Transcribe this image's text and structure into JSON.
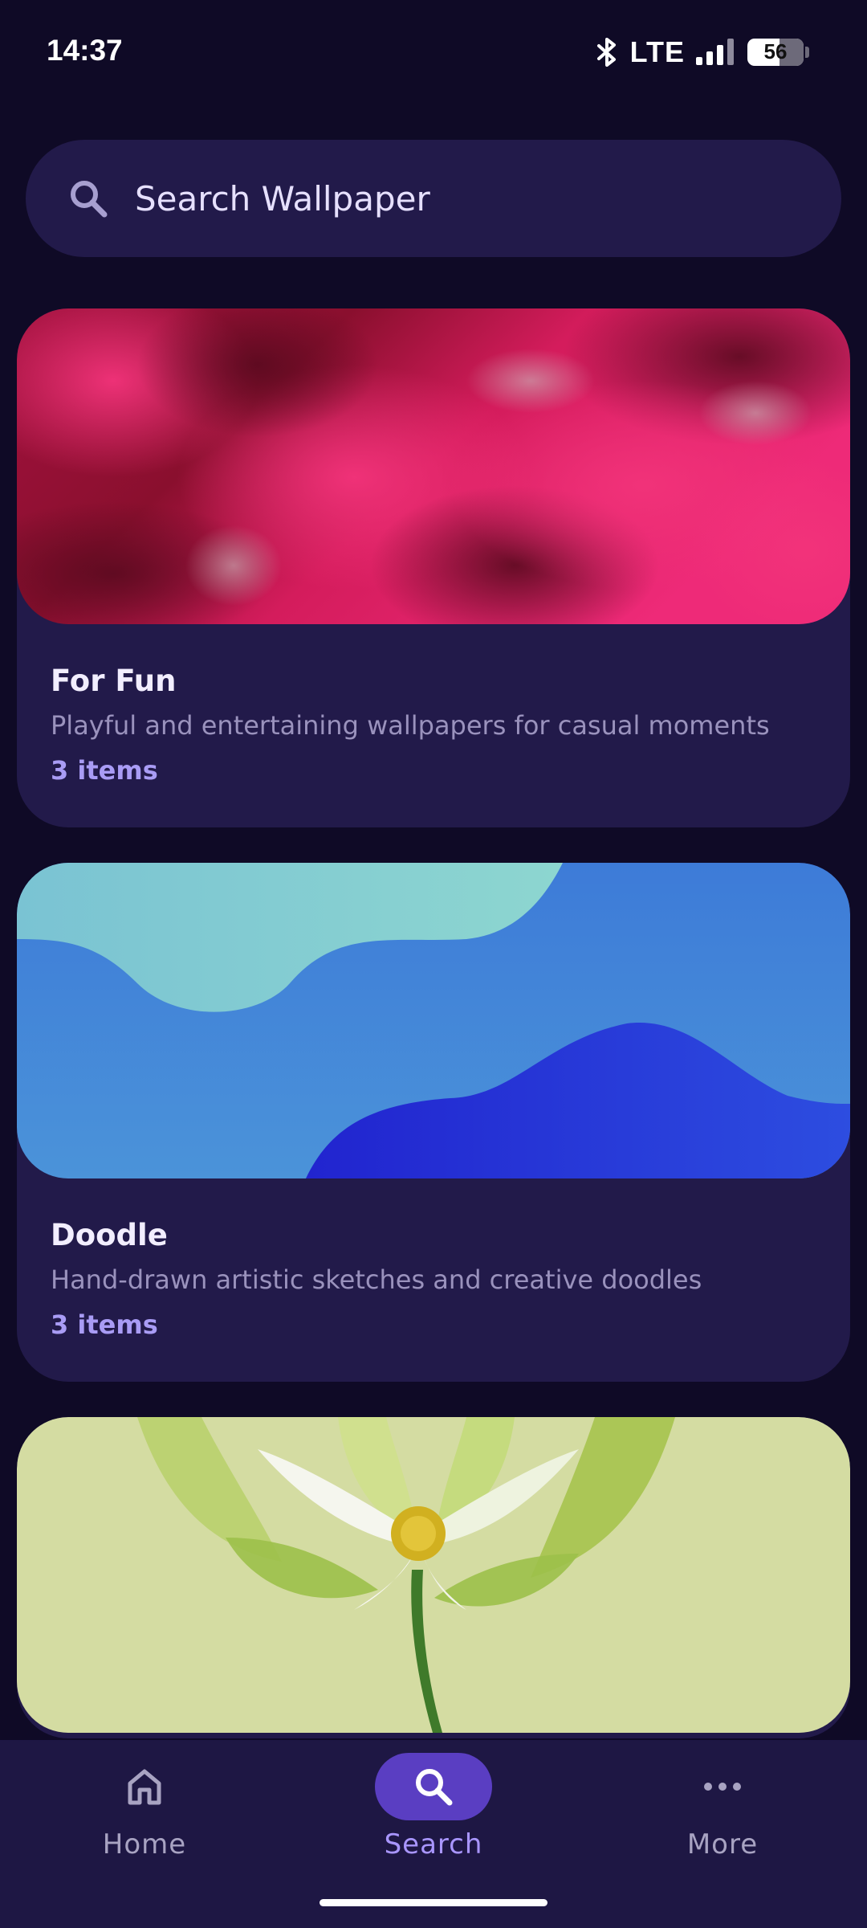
{
  "status_bar": {
    "time": "14:37",
    "network": "LTE",
    "battery": "56",
    "icons": [
      "bluetooth-icon",
      "signal-icon",
      "battery-icon"
    ]
  },
  "search": {
    "placeholder": "Search Wallpaper",
    "icon": "search-icon"
  },
  "categories": [
    {
      "title": "For Fun",
      "description": "Playful and entertaining wallpapers for casual moments",
      "count": "3 items",
      "image": "pink-clouds"
    },
    {
      "title": "Doodle",
      "description": "Hand-drawn artistic sketches and creative doodles",
      "count": "3 items",
      "image": "blue-waves"
    },
    {
      "title": "",
      "description": "",
      "count": "",
      "image": "green-flower"
    }
  ],
  "bottom_nav": {
    "items": [
      {
        "label": "Home",
        "icon": "home-icon",
        "active": false
      },
      {
        "label": "Search",
        "icon": "search-icon",
        "active": true
      },
      {
        "label": "More",
        "icon": "more-icon",
        "active": false
      }
    ]
  },
  "colors": {
    "background": "#0f0a26",
    "card": "#221a4a",
    "accent": "#5a3ec2",
    "accent_text": "#a996ff",
    "count_text": "#a99cf5"
  }
}
